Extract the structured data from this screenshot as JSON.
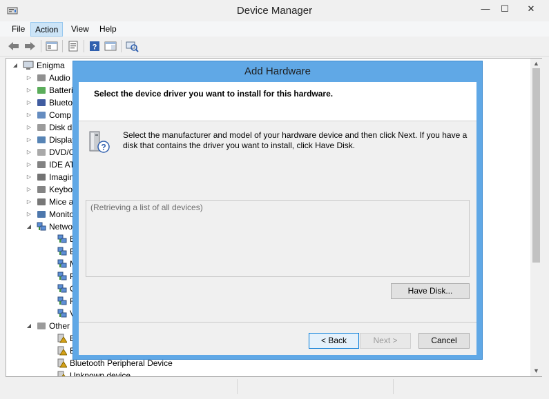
{
  "window": {
    "title": "Device Manager",
    "controls": {
      "minimize": "—",
      "maximize": "☐",
      "close": "✕"
    }
  },
  "menubar": {
    "items": [
      {
        "label": "File"
      },
      {
        "label": "Action",
        "active": true
      },
      {
        "label": "View"
      },
      {
        "label": "Help"
      }
    ]
  },
  "toolbar": {
    "icons": [
      "back-arrow-icon",
      "forward-arrow-icon",
      "show-hide-tree-icon",
      "properties-icon",
      "help-icon",
      "action-pane-icon",
      "scan-hardware-icon"
    ]
  },
  "tree": {
    "root": "Enigma",
    "items": [
      {
        "label": "Audio",
        "icon": "speaker-icon",
        "expander": "closed"
      },
      {
        "label": "Batteri",
        "icon": "battery-icon",
        "expander": "closed"
      },
      {
        "label": "Blueto",
        "icon": "bluetooth-icon",
        "expander": "closed"
      },
      {
        "label": "Comp",
        "icon": "computer-icon",
        "expander": "closed"
      },
      {
        "label": "Disk dr",
        "icon": "disk-drive-icon",
        "expander": "closed"
      },
      {
        "label": "Display",
        "icon": "display-adapter-icon",
        "expander": "closed"
      },
      {
        "label": "DVD/C",
        "icon": "dvd-drive-icon",
        "expander": "closed"
      },
      {
        "label": "IDE AT",
        "icon": "ide-controller-icon",
        "expander": "closed"
      },
      {
        "label": "Imagin",
        "icon": "camera-icon",
        "expander": "closed"
      },
      {
        "label": "Keybo",
        "icon": "keyboard-icon",
        "expander": "closed"
      },
      {
        "label": "Mice a",
        "icon": "mouse-icon",
        "expander": "closed"
      },
      {
        "label": "Monito",
        "icon": "monitor-icon",
        "expander": "closed"
      },
      {
        "label": "Netwo",
        "icon": "network-adapter-icon",
        "expander": "open"
      },
      {
        "label": "Blu",
        "icon": "network-adapter-icon",
        "child": true
      },
      {
        "label": "Blu",
        "icon": "network-adapter-icon",
        "child": true
      },
      {
        "label": "Mi",
        "icon": "network-adapter-icon",
        "child": true
      },
      {
        "label": "Pd",
        "icon": "network-adapter-icon",
        "child": true
      },
      {
        "label": "Qu",
        "icon": "network-adapter-icon",
        "child": true
      },
      {
        "label": "Rea",
        "icon": "network-adapter-icon",
        "child": true
      },
      {
        "label": "Vir",
        "icon": "network-adapter-icon",
        "child": true
      },
      {
        "label": "Other",
        "icon": "other-devices-icon",
        "expander": "open"
      },
      {
        "label": "Bas",
        "icon": "warning-device-icon",
        "child": true
      },
      {
        "label": "Bas",
        "icon": "warning-device-icon",
        "child": true
      },
      {
        "label": "Bluetooth Peripheral Device",
        "icon": "warning-device-icon",
        "child": true
      },
      {
        "label": "Unknown device",
        "icon": "warning-device-icon",
        "child": true
      }
    ]
  },
  "dialog": {
    "title": "Add Hardware",
    "header": "Select the device driver you want to install for this hardware.",
    "description": "Select the manufacturer and model of your hardware device and then click Next. If you have a disk that contains the driver you want to install, click Have Disk.",
    "list_placeholder": "(Retrieving a list of all devices)",
    "buttons": {
      "have_disk": "Have Disk...",
      "back": "< Back",
      "next": "Next >",
      "cancel": "Cancel"
    }
  }
}
